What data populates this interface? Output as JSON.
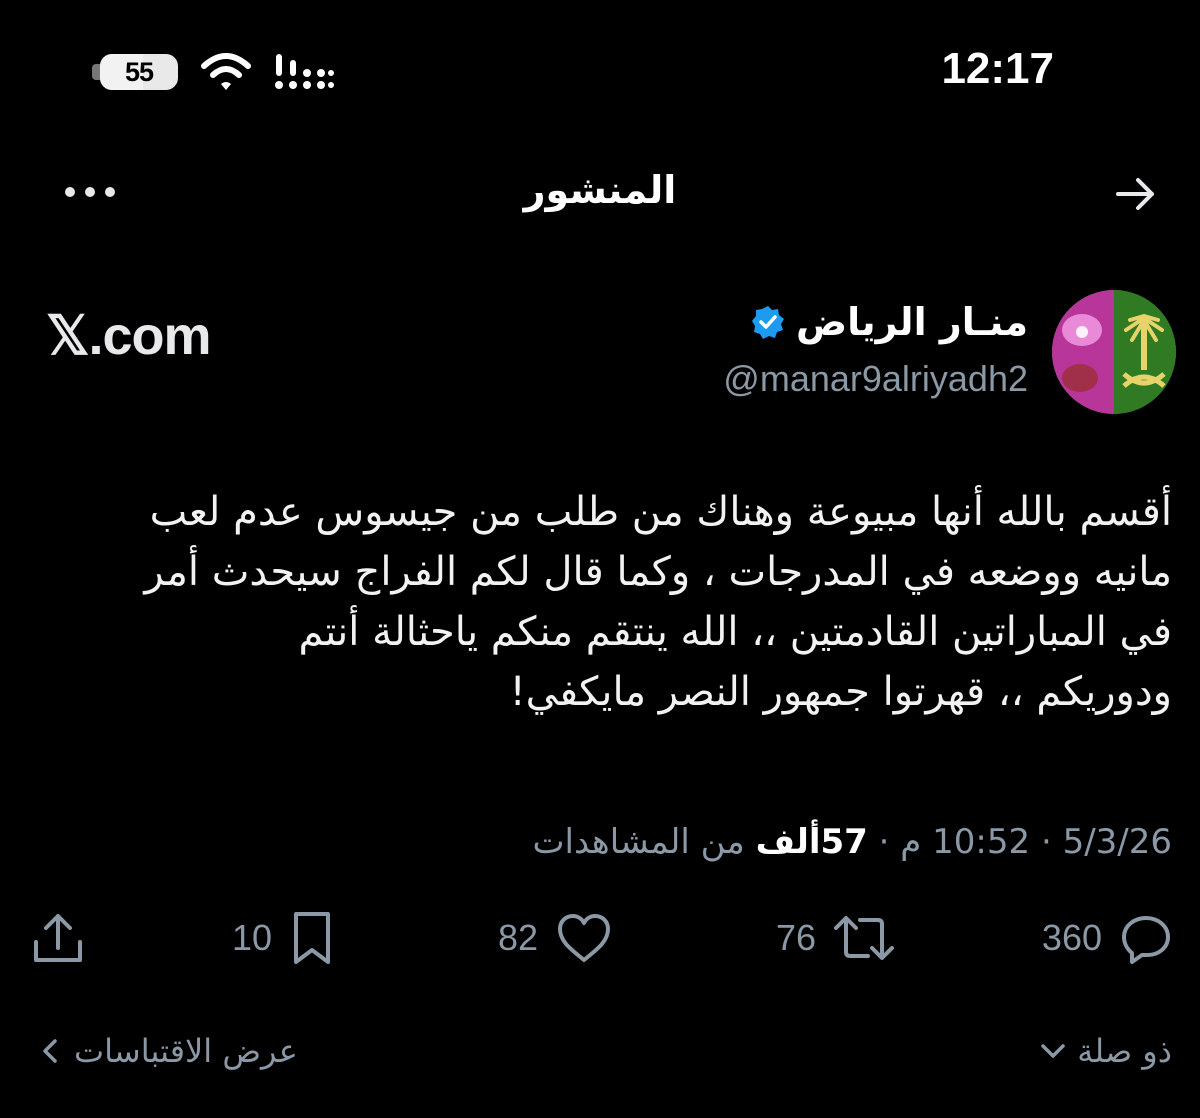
{
  "status_bar": {
    "battery": "55",
    "battery_fraction": 0.55,
    "time": "12:17"
  },
  "header": {
    "title": "المنشور",
    "more_icon": "more-horizontal-icon",
    "back_icon": "arrow-right-icon"
  },
  "source_watermark": "𝕏.com",
  "author": {
    "display_name": "منـار الرياض",
    "handle": "@manar9alriyadh2",
    "verified": true
  },
  "post": {
    "lines": [
      "أقسم بالله أنها مبيوعة وهناك من طلب من جيسوس عدم لعب",
      "مانيه ووضعه في المدرجات ، وكما قال لكم الفراج سيحدث أمر",
      "في المباراتين  القادمتين ،، الله ينتقم منكم ياحثالة أنتم",
      "ودوريكم ،، قهرتوا جمهور النصر مايكفي!"
    ]
  },
  "meta": {
    "date": "5/3/26",
    "time": "10:52 م",
    "separator": "·",
    "views_count": "57ألف",
    "views_label": "من المشاهدات"
  },
  "actions": {
    "replies": "360",
    "reposts": "76",
    "likes": "82",
    "bookmarks": "10"
  },
  "footer": {
    "quotes_link": "عرض الاقتباسات",
    "sort_label": "ذو صلة"
  },
  "colors": {
    "background": "#000000",
    "text": "#e7e9ea",
    "muted": "#8b98a5",
    "verified_blue": "#1d9bf0"
  }
}
